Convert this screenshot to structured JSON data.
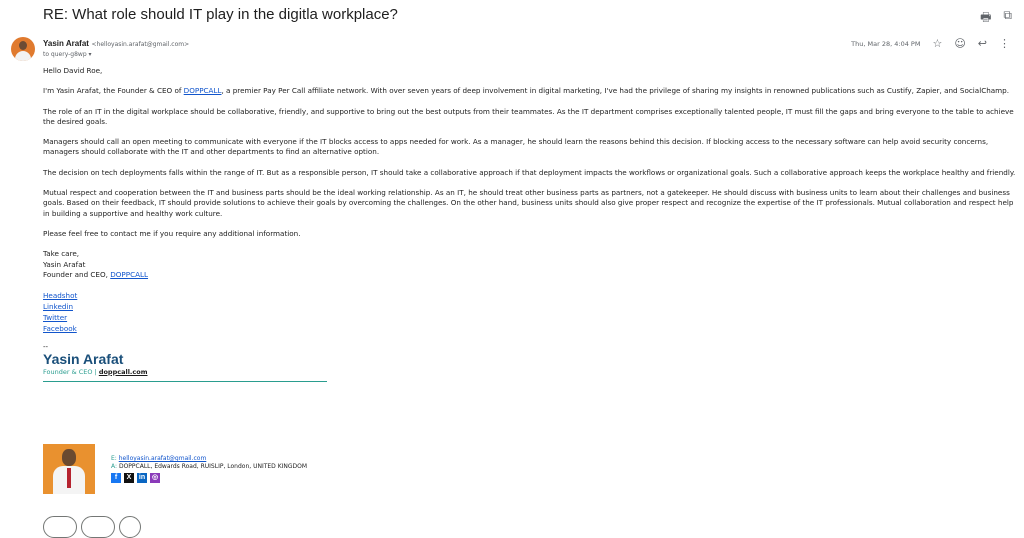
{
  "subject": "RE: What role should IT play in the digitla workplace?",
  "sender": {
    "name": "Yasin Arafat",
    "email": "<helloyasin.arafat@gmail.com>"
  },
  "to": "to query-g8wp ▾",
  "date": "Thu, Mar 28, 4:04 PM",
  "greeting": "Hello David Roe,",
  "para1": {
    "pre": "I'm Yasin Arafat, the Founder & CEO of ",
    "link": "DOPPCALL",
    "post": ", a premier Pay Per Call affiliate network. With over seven years of deep involvement in digital marketing, I've had the privilege of sharing my insights in renowned publications such as Custify, Zapier, and SocialChamp."
  },
  "para2": "The role of an IT in the digital workplace should be collaborative, friendly, and supportive to bring out the best outputs from their teammates. As the IT department comprises exceptionally talented people, IT must fill the gaps and bring everyone to the table to achieve the desired goals.",
  "para3": "Managers should call an open meeting to communicate with everyone if the IT blocks access to apps needed for work. As a manager, he should learn the reasons behind this decision. If blocking access to the necessary software can help avoid security concerns, managers should collaborate with the IT and other departments to find an alternative option.",
  "para4": "The decision on tech deployments falls within the range of IT. But as a responsible person, IT should take a collaborative approach if that deployment impacts the workflows or organizational goals. Such a collaborative approach keeps the workplace healthy and friendly.",
  "para5": "Mutual respect and cooperation between the IT and business parts should be the ideal working relationship. As an IT, he should treat other business parts as partners, not a gatekeeper. He should discuss with business units to learn about their challenges and business goals. Based on their feedback, IT should provide solutions to achieve their goals by overcoming the challenges. On the other hand, business units should also give proper respect and recognize the expertise of the IT professionals. Mutual collaboration and respect help in building a supportive and healthy work culture.",
  "para6": "Please feel free to contact me if you require any additional information.",
  "signoff": {
    "line1": "Take care,",
    "line2": "Yasin Arafat",
    "line3_pre": "Founder and CEO, ",
    "line3_link": "DOPPCALL"
  },
  "links": [
    "Headshot",
    "Linkedin",
    "Twitter",
    "Facebook"
  ],
  "signature": {
    "dash": "--",
    "name": "Yasin Arafat",
    "title": "Founder & CEO | ",
    "site": "doppcall.com",
    "email_key": "E:",
    "email": "helloyasin.arafat@gmail.com",
    "address_key": "A:",
    "address": "DOPPCALL, Edwards Road, RUISLIP, London, UNITED KINGDOM"
  },
  "icons": {
    "print": "print-icon",
    "open": "open-in-new-icon",
    "star": "star-icon",
    "emoji": "emoji-icon",
    "reply": "reply-icon",
    "more": "more-vert-icon"
  },
  "colors": {
    "link": "#1155cc",
    "sig_name": "#1a4f7a",
    "sig_accent": "#2a9d8f"
  }
}
